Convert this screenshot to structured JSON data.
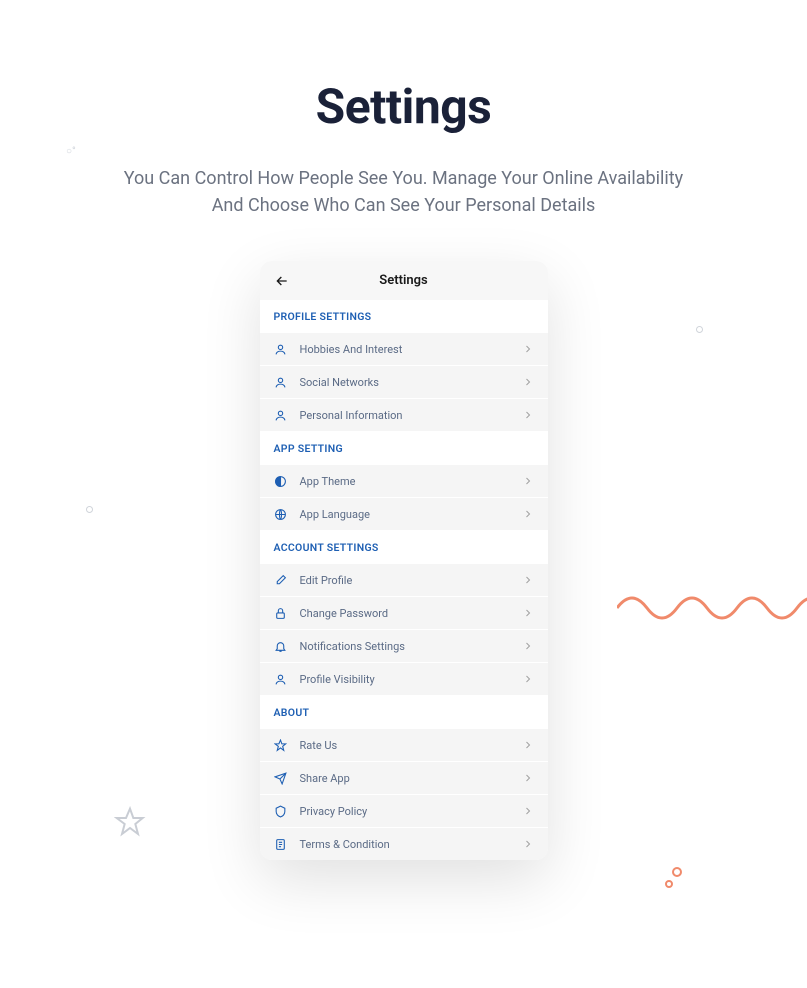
{
  "page": {
    "title": "Settings",
    "subtitle": "You Can Control How People See You. Manage Your Online Availability And Choose Who Can See Your Personal Details"
  },
  "phone": {
    "header_title": "Settings"
  },
  "sections": {
    "profile": {
      "header": "PROFILE SETTINGS",
      "items": {
        "hobbies": "Hobbies And Interest",
        "social": "Social Networks",
        "personal": "Personal Information"
      }
    },
    "app": {
      "header": "APP SETTING",
      "items": {
        "theme": "App Theme",
        "language": "App Language"
      }
    },
    "account": {
      "header": "ACCOUNT SETTINGS",
      "items": {
        "edit": "Edit Profile",
        "password": "Change Password",
        "notifications": "Notifications Settings",
        "visibility": "Profile Visibility"
      }
    },
    "about": {
      "header": "ABOUT",
      "items": {
        "rate": "Rate Us",
        "share": "Share App",
        "privacy": "Privacy Policy",
        "terms": "Terms & Condition"
      }
    }
  }
}
